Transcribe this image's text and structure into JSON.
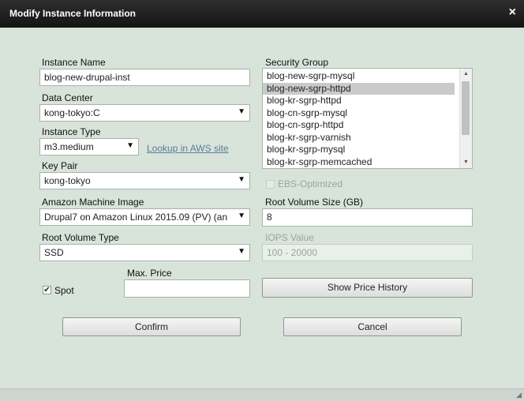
{
  "window": {
    "title": "Modify Instance Information",
    "close_glyph": "×"
  },
  "instance_name": {
    "label": "Instance Name",
    "value": "blog-new-drupal-inst"
  },
  "data_center": {
    "label": "Data Center",
    "value": "kong-tokyo:C"
  },
  "instance_type": {
    "label": "Instance Type",
    "value": "m3.medium",
    "lookup_link": "Lookup in AWS site"
  },
  "key_pair": {
    "label": "Key Pair",
    "value": "kong-tokyo"
  },
  "ami": {
    "label": "Amazon Machine Image",
    "value": "Drupal7 on Amazon Linux 2015.09 (PV) (an"
  },
  "root_volume_type": {
    "label": "Root Volume Type",
    "value": "SSD"
  },
  "spot": {
    "label": "Spot",
    "checked": true,
    "check_glyph": "✔"
  },
  "max_price": {
    "label": "Max. Price",
    "value": ""
  },
  "security_group": {
    "label": "Security Group",
    "items": [
      "blog-new-sgrp-mysql",
      "blog-new-sgrp-httpd",
      "blog-kr-sgrp-httpd",
      "blog-cn-sgrp-mysql",
      "blog-cn-sgrp-httpd",
      "blog-kr-sgrp-varnish",
      "blog-kr-sgrp-mysql",
      "blog-kr-sgrp-memcached"
    ],
    "selected_index": 1
  },
  "ebs_optimized": {
    "label": "EBS-Optimized",
    "checked": false
  },
  "root_volume_size": {
    "label": "Root Volume Size (GB)",
    "value": "8"
  },
  "iops": {
    "label": "IOPS Value",
    "placeholder": "100 - 20000"
  },
  "buttons": {
    "show_price_history": "Show Price History",
    "confirm": "Confirm",
    "cancel": "Cancel"
  },
  "colors": {
    "dialog_bg": "#d8e3da",
    "titlebar_bg": "#1e1e1e",
    "link": "#5a7c9a",
    "selection": "#c8cbc9"
  }
}
